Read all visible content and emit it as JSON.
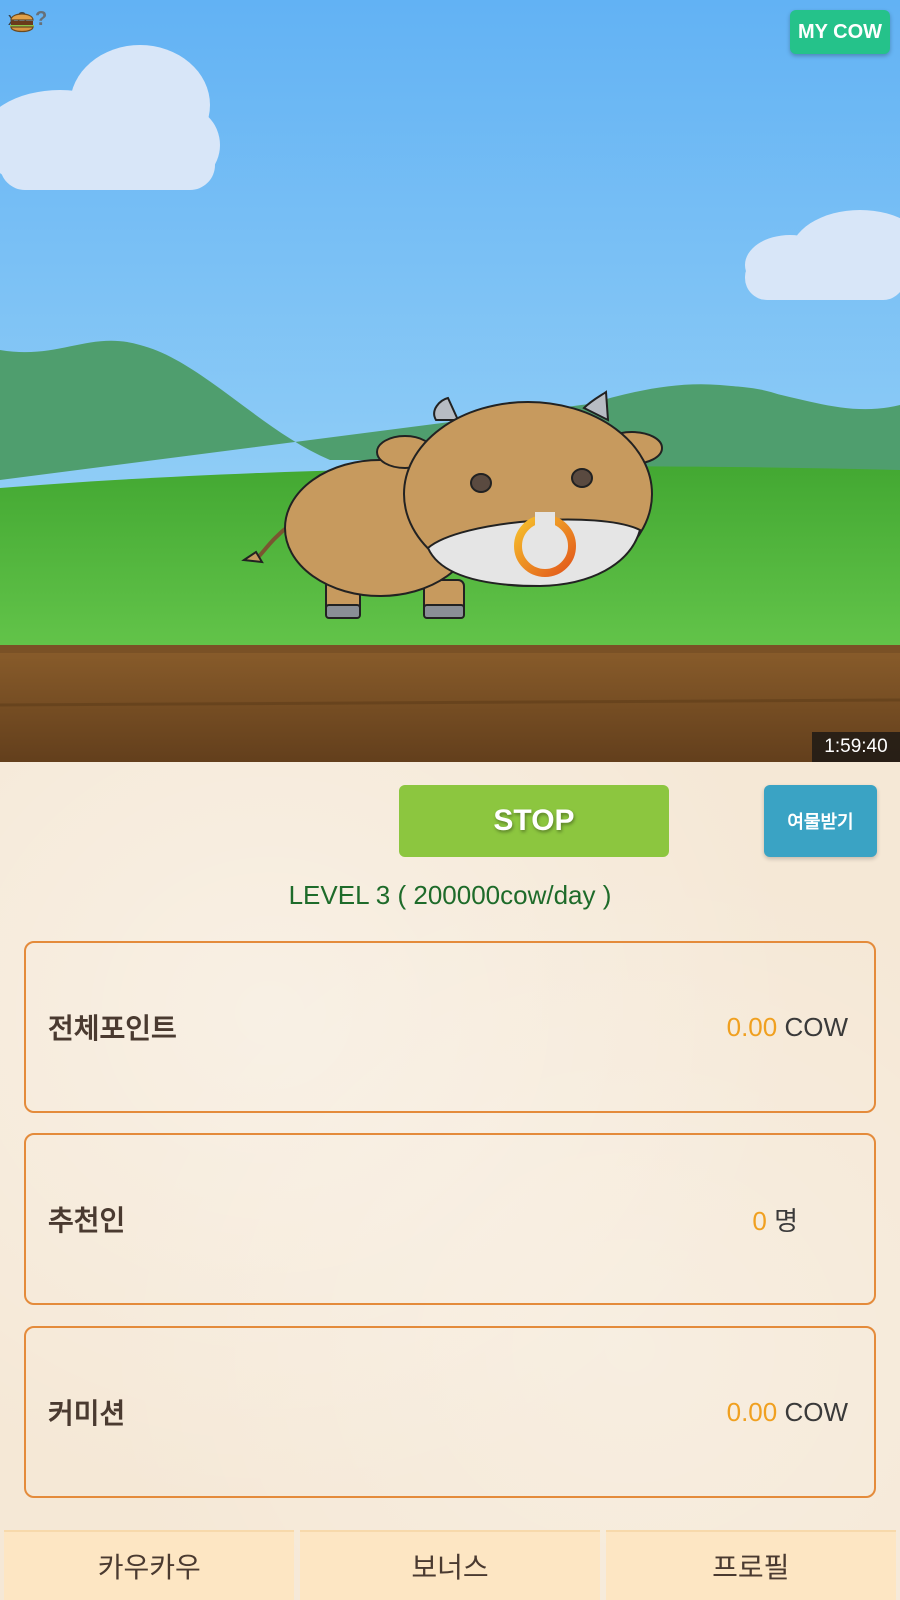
{
  "hud": {
    "item_count": "x0",
    "help_glyph": "?",
    "my_cow_label": "MY COW",
    "timer": "1:59:40"
  },
  "actions": {
    "stop_label": "STOP",
    "gift_label": "여물받기"
  },
  "level_text": "LEVEL  3 ( 200000cow/day )",
  "stats": [
    {
      "label": "전체포인트",
      "value": "0.00",
      "unit": "COW"
    },
    {
      "label": "추천인",
      "value": "0",
      "unit": "명"
    },
    {
      "label": "커미션",
      "value": "0.00",
      "unit": "COW"
    }
  ],
  "nav": [
    {
      "label": "카우카우"
    },
    {
      "label": "보너스"
    },
    {
      "label": "프로필"
    }
  ],
  "colors": {
    "sky": "#6db9f3",
    "grass": "#52b043",
    "soil": "#6e4a22",
    "accent_green": "#8cc63f",
    "gift_blue": "#3aa3c4",
    "value_orange": "#f0a020",
    "card_border": "#e48b3b"
  },
  "icons": [
    "burger-icon",
    "help-icon"
  ]
}
